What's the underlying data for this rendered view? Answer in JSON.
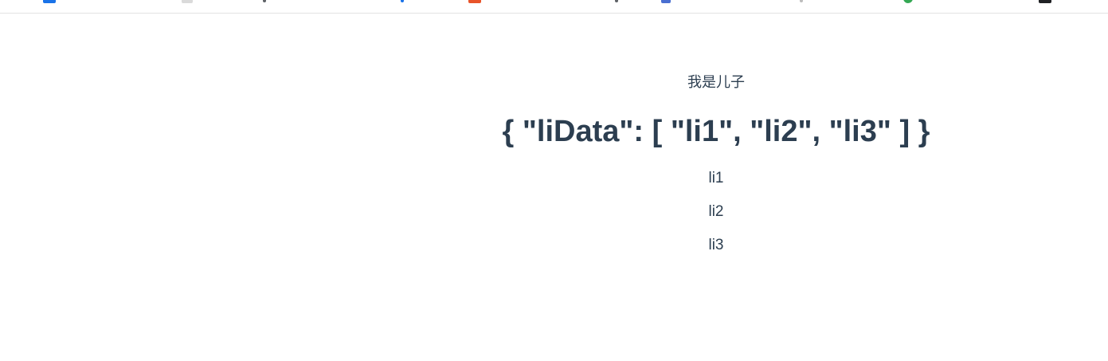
{
  "page": {
    "son_text": "我是儿子",
    "json_heading": "{ \"liData\": [ \"li1\", \"li2\", \"li3\" ] }",
    "items": [
      "li1",
      "li2",
      "li3"
    ]
  },
  "bookmarks_bar": {
    "icon_colors": [
      "#1a73e8",
      "#dadada",
      "#5f6368",
      "#1a73e8",
      "#e8542a",
      "#5f6368",
      "#4a6fd1",
      "#bdbdbd",
      "#34a853",
      "#202124"
    ]
  },
  "colors": {
    "text": "#2c3e50",
    "background": "#ffffff"
  }
}
